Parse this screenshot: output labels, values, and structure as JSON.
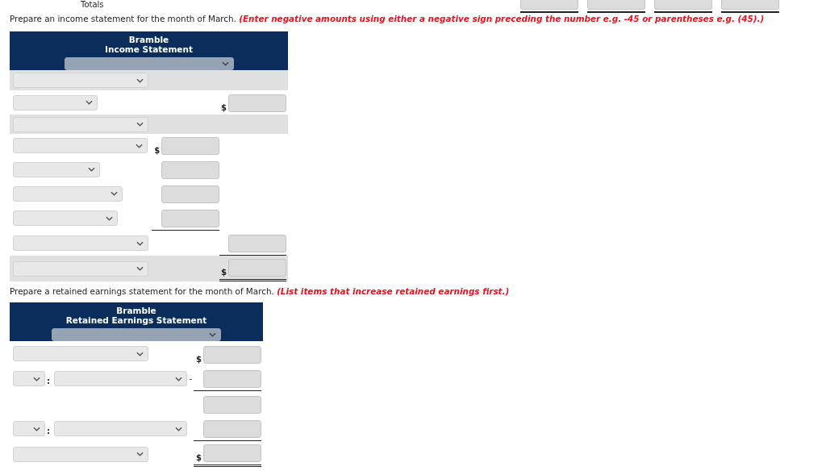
{
  "totals_label": "Totals",
  "totals_fields": [
    {
      "underlined": true
    },
    {
      "underlined": true
    },
    {
      "underlined": true
    },
    {
      "underlined": true
    }
  ],
  "income_instruction": {
    "text": "Prepare an income statement for the month of March.",
    "note": "(Enter negative amounts using either a negative sign preceding the number e.g. -45 or parentheses e.g. (45).)"
  },
  "income_statement": {
    "company": "Bramble",
    "title": "Income Statement",
    "rows": [
      {
        "shaded": true,
        "kind": "heading"
      },
      {
        "shaded": false,
        "kind": "total",
        "currency": "$",
        "underlined": false,
        "double_underlined": false
      },
      {
        "shaded": true,
        "kind": "heading"
      },
      {
        "shaded": false,
        "kind": "item",
        "currency": "$",
        "underlined": false,
        "double_underlined": false
      },
      {
        "shaded": false,
        "kind": "item",
        "underlined": false,
        "double_underlined": false
      },
      {
        "shaded": false,
        "kind": "item",
        "underlined": false,
        "double_underlined": false
      },
      {
        "shaded": false,
        "kind": "item",
        "underlined": true,
        "double_underlined": false
      },
      {
        "shaded": false,
        "kind": "total",
        "underlined": true,
        "double_underlined": false
      },
      {
        "shaded": true,
        "kind": "total",
        "currency": "$",
        "underlined": false,
        "double_underlined": true
      }
    ]
  },
  "retained_instruction": {
    "text": "Prepare a retained earnings statement for the month of March.",
    "note": "(List items that increase retained earnings first.)"
  },
  "retained_earnings_statement": {
    "company": "Bramble",
    "title": "Retained Earnings Statement",
    "rows": [
      {
        "kind": "single",
        "currency": "$",
        "underlined": false,
        "double_underlined": false
      },
      {
        "kind": "pair",
        "separator": ":",
        "sign": "-",
        "underlined": true,
        "double_underlined": false
      },
      {
        "kind": "amount",
        "underlined": false,
        "double_underlined": false
      },
      {
        "kind": "pair",
        "separator": ":",
        "underlined": true,
        "double_underlined": false
      },
      {
        "kind": "single",
        "currency": "$",
        "underlined": false,
        "double_underlined": true
      }
    ]
  }
}
